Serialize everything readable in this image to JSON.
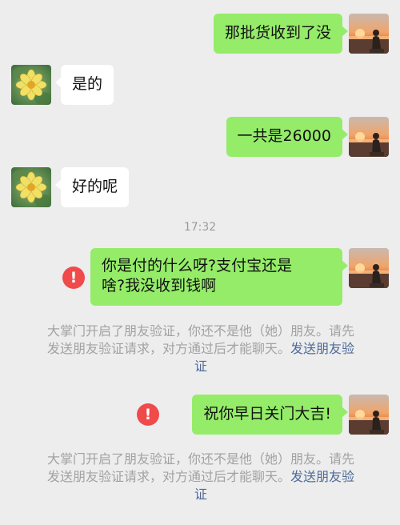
{
  "messages": [
    {
      "side": "out",
      "text": "那批货收到了没"
    },
    {
      "side": "in",
      "text": "是的"
    },
    {
      "side": "out",
      "text": "一共是26000"
    },
    {
      "side": "in",
      "text": "好的呢"
    },
    {
      "side": "out",
      "text_line1": "你是付的什么呀?支付宝还是",
      "text_line2": "啥?我没收到钱啊",
      "failed": true
    },
    {
      "side": "out",
      "text": "祝你早日关门大吉!",
      "failed": true
    }
  ],
  "timestamp": "17:32",
  "system_notice": {
    "line1": "大掌门开启了朋友验证，你还不是他（她）朋友。请先",
    "line2_prefix": "发送朋友验证请求，对方通过后才能聊天。",
    "link_part1": "发送朋友验",
    "link_part2": "证"
  },
  "error_glyph": "!",
  "colors": {
    "background": "#ededed",
    "outgoing_bubble": "#95ec69",
    "incoming_bubble": "#ffffff",
    "error": "#f04a4a",
    "link": "#4d6a9a"
  },
  "icons": {
    "self_avatar": "sunset-silhouette-avatar",
    "contact_avatar": "yellow-flower-avatar",
    "send_failed": "exclamation-circle-icon"
  }
}
